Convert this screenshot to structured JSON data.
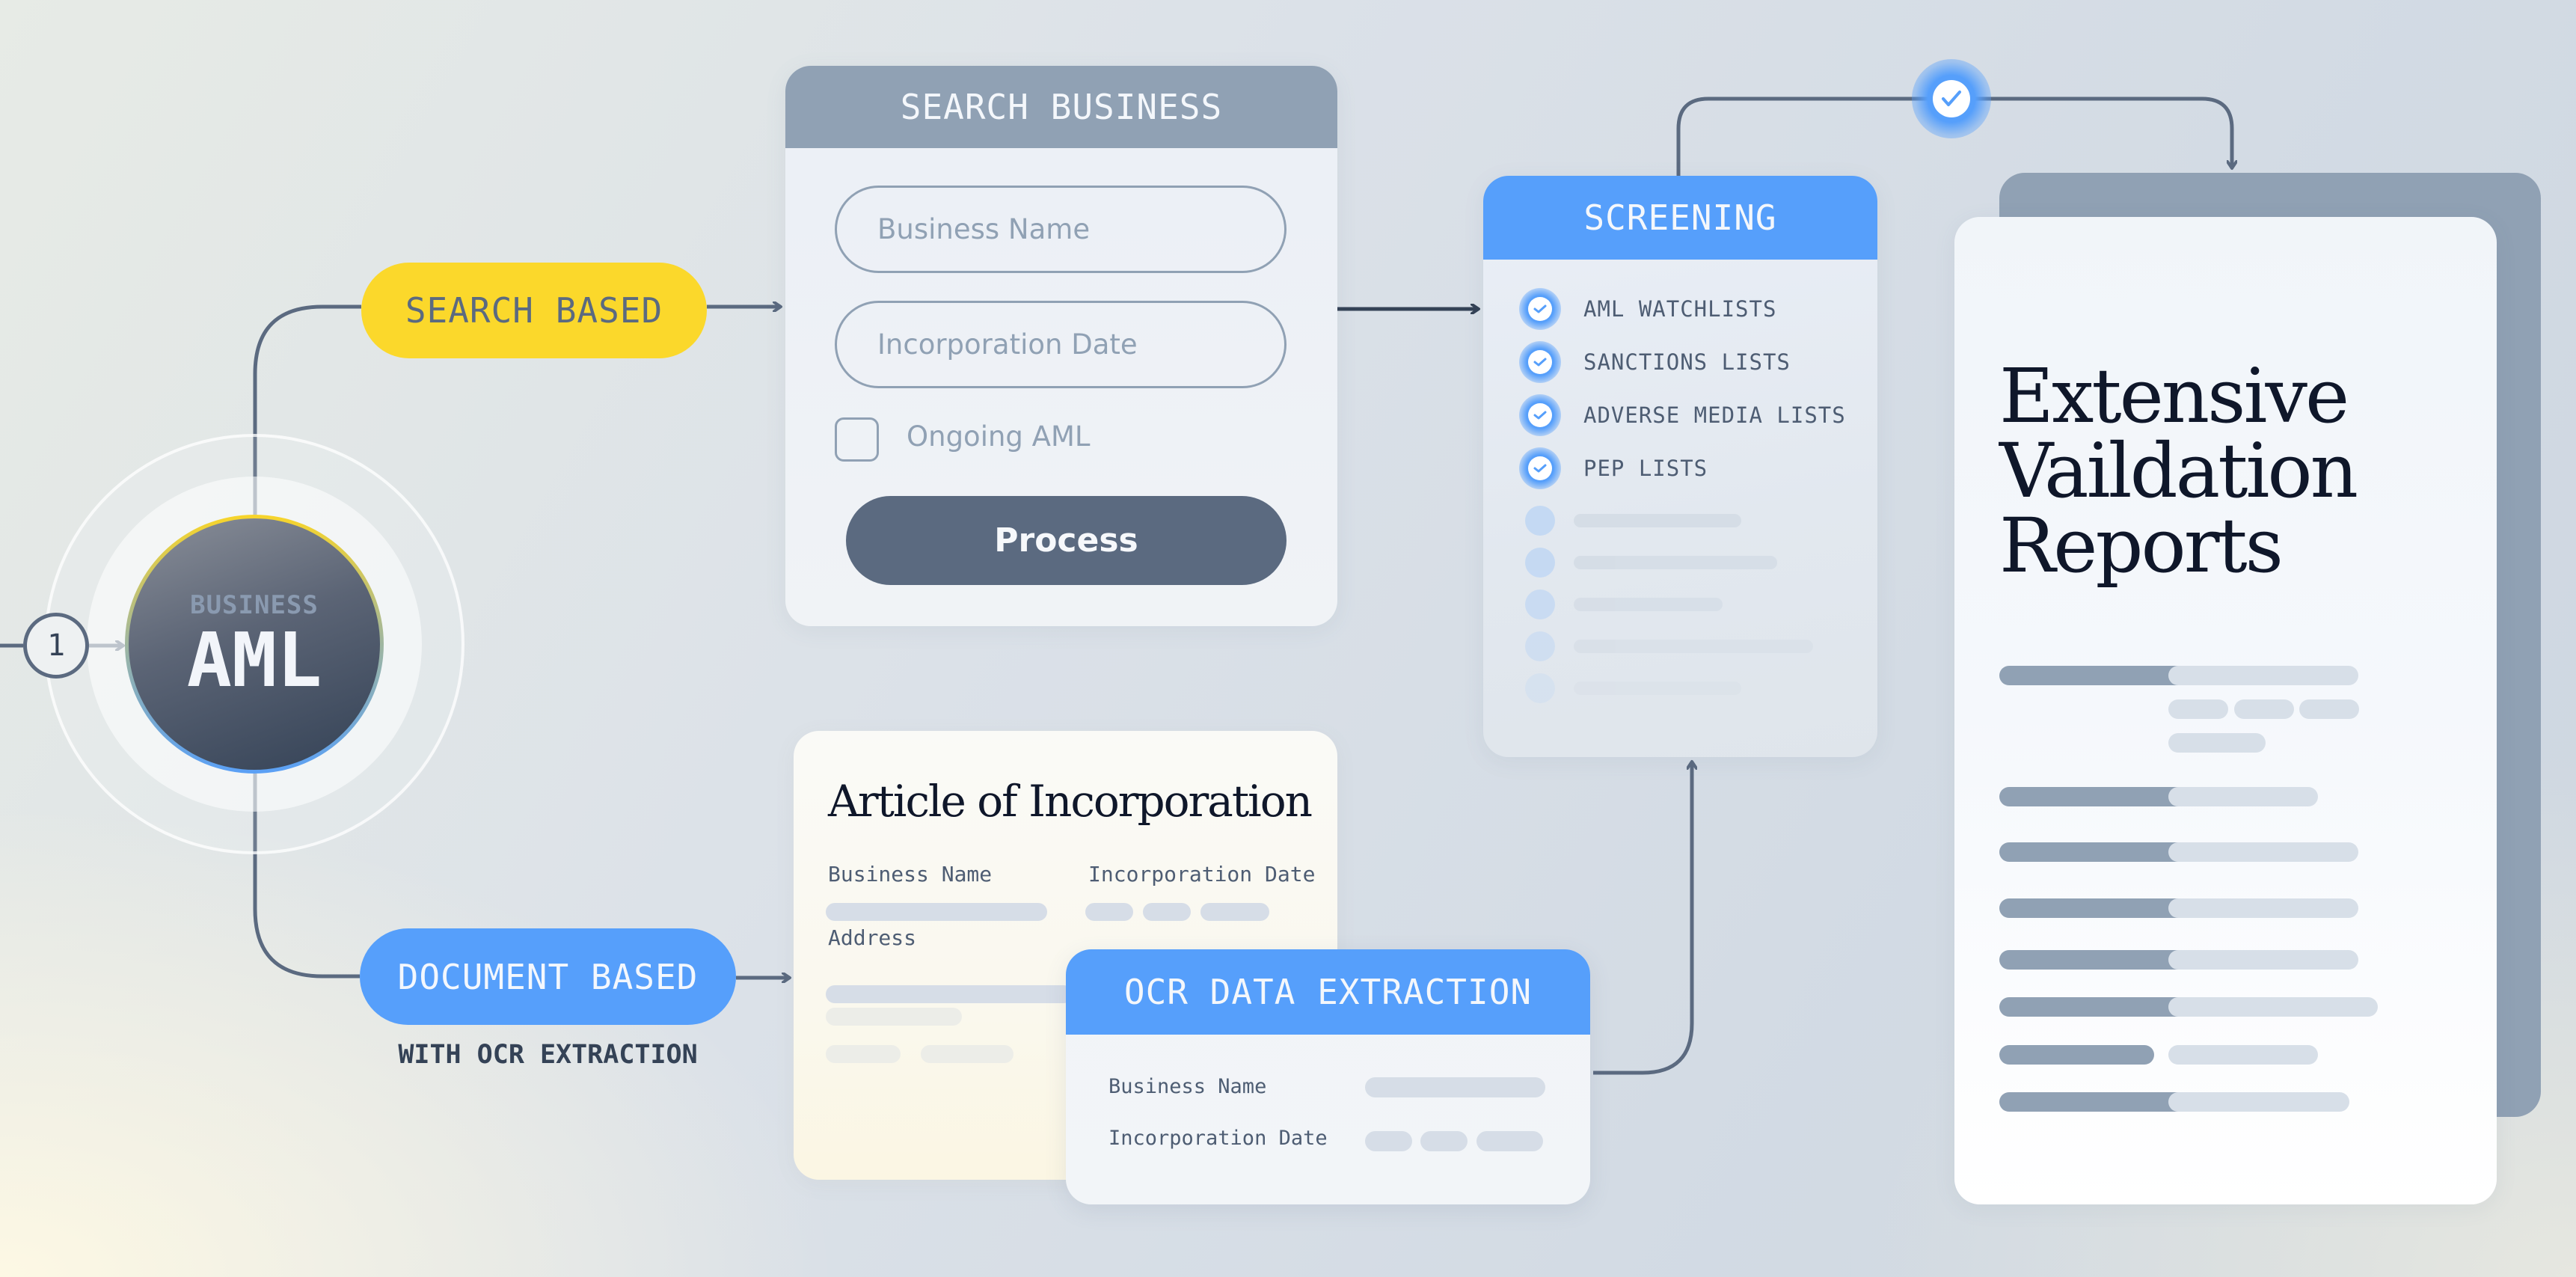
{
  "hub": {
    "step_number": "1",
    "subtitle": "BUSINESS",
    "title": "AML"
  },
  "branches": {
    "search": {
      "label": "SEARCH BASED"
    },
    "document": {
      "label": "DOCUMENT BASED",
      "sublabel": "WITH OCR EXTRACTION"
    }
  },
  "search_card": {
    "title": "SEARCH BUSINESS",
    "business_name_placeholder": "Business Name",
    "incorporation_date_placeholder": "Incorporation Date",
    "ongoing_label": "Ongoing AML",
    "ongoing_checked": false,
    "process_label": "Process"
  },
  "screening_card": {
    "title": "SCREENING",
    "items": [
      {
        "label": "AML WATCHLISTS",
        "checked": true
      },
      {
        "label": "SANCTIONS LISTS",
        "checked": true
      },
      {
        "label": "ADVERSE MEDIA LISTS",
        "checked": true
      },
      {
        "label": "PEP LISTS",
        "checked": true
      }
    ],
    "placeholder_rows": 5
  },
  "article_card": {
    "title": "Article of Incorporation",
    "fields": {
      "business_name": "Business Name",
      "incorporation_date": "Incorporation Date",
      "address": "Address"
    }
  },
  "ocr_card": {
    "title": "OCR DATA EXTRACTION",
    "fields": {
      "business_name": "Business Name",
      "incorporation_date": "Incorporation Date"
    }
  },
  "report_card": {
    "title_lines": [
      "Extensive",
      "Vaildation",
      "Reports"
    ]
  },
  "colors": {
    "accent_blue": "#569ffb",
    "accent_yellow": "#fbd82b",
    "slate": "#5b6a80",
    "slate_light": "#90a1b4",
    "ink": "#0f172a"
  }
}
